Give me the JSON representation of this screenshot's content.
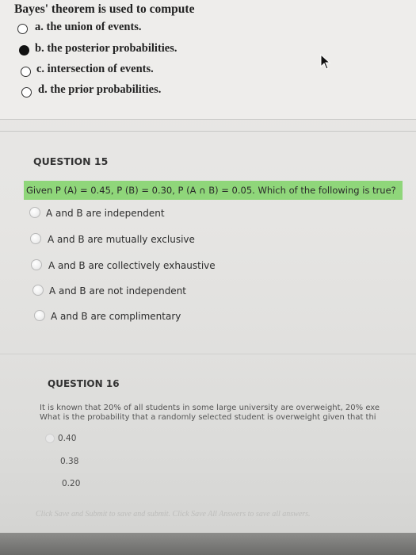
{
  "q14": {
    "prompt": "Bayes' theorem is used to compute",
    "options": [
      {
        "label": "a. the union of events.",
        "selected": false
      },
      {
        "label": "b. the posterior probabilities.",
        "selected": true
      },
      {
        "label": "c. intersection of events.",
        "selected": false
      },
      {
        "label": "d. the prior probabilities.",
        "selected": false
      }
    ]
  },
  "q15": {
    "heading": "QUESTION 15",
    "prompt": "Given P (A) = 0.45, P (B) = 0.30, P (A ∩ B) = 0.05. Which of the following is true?",
    "highlight_color": "#8fd67a",
    "options": [
      {
        "label": "A and B are independent"
      },
      {
        "label": "A and B are mutually exclusive"
      },
      {
        "label": "A and B are collectively exhaustive"
      },
      {
        "label": "A and B are not independent"
      },
      {
        "label": "A and B are complimentary"
      }
    ]
  },
  "q16": {
    "heading": "QUESTION 16",
    "line1": "It is known that 20% of all students in some large university are overweight, 20% exe",
    "line2": "What is the probability that a randomly selected student is overweight given that thi",
    "options": [
      {
        "label": "0.40"
      },
      {
        "label": "0.38"
      },
      {
        "label": "0.20"
      }
    ]
  },
  "footer": {
    "note": "Click Save and Submit to save and submit. Click Save All Answers to save all answers."
  },
  "icons": {
    "cursor": "mouse-pointer-icon"
  }
}
